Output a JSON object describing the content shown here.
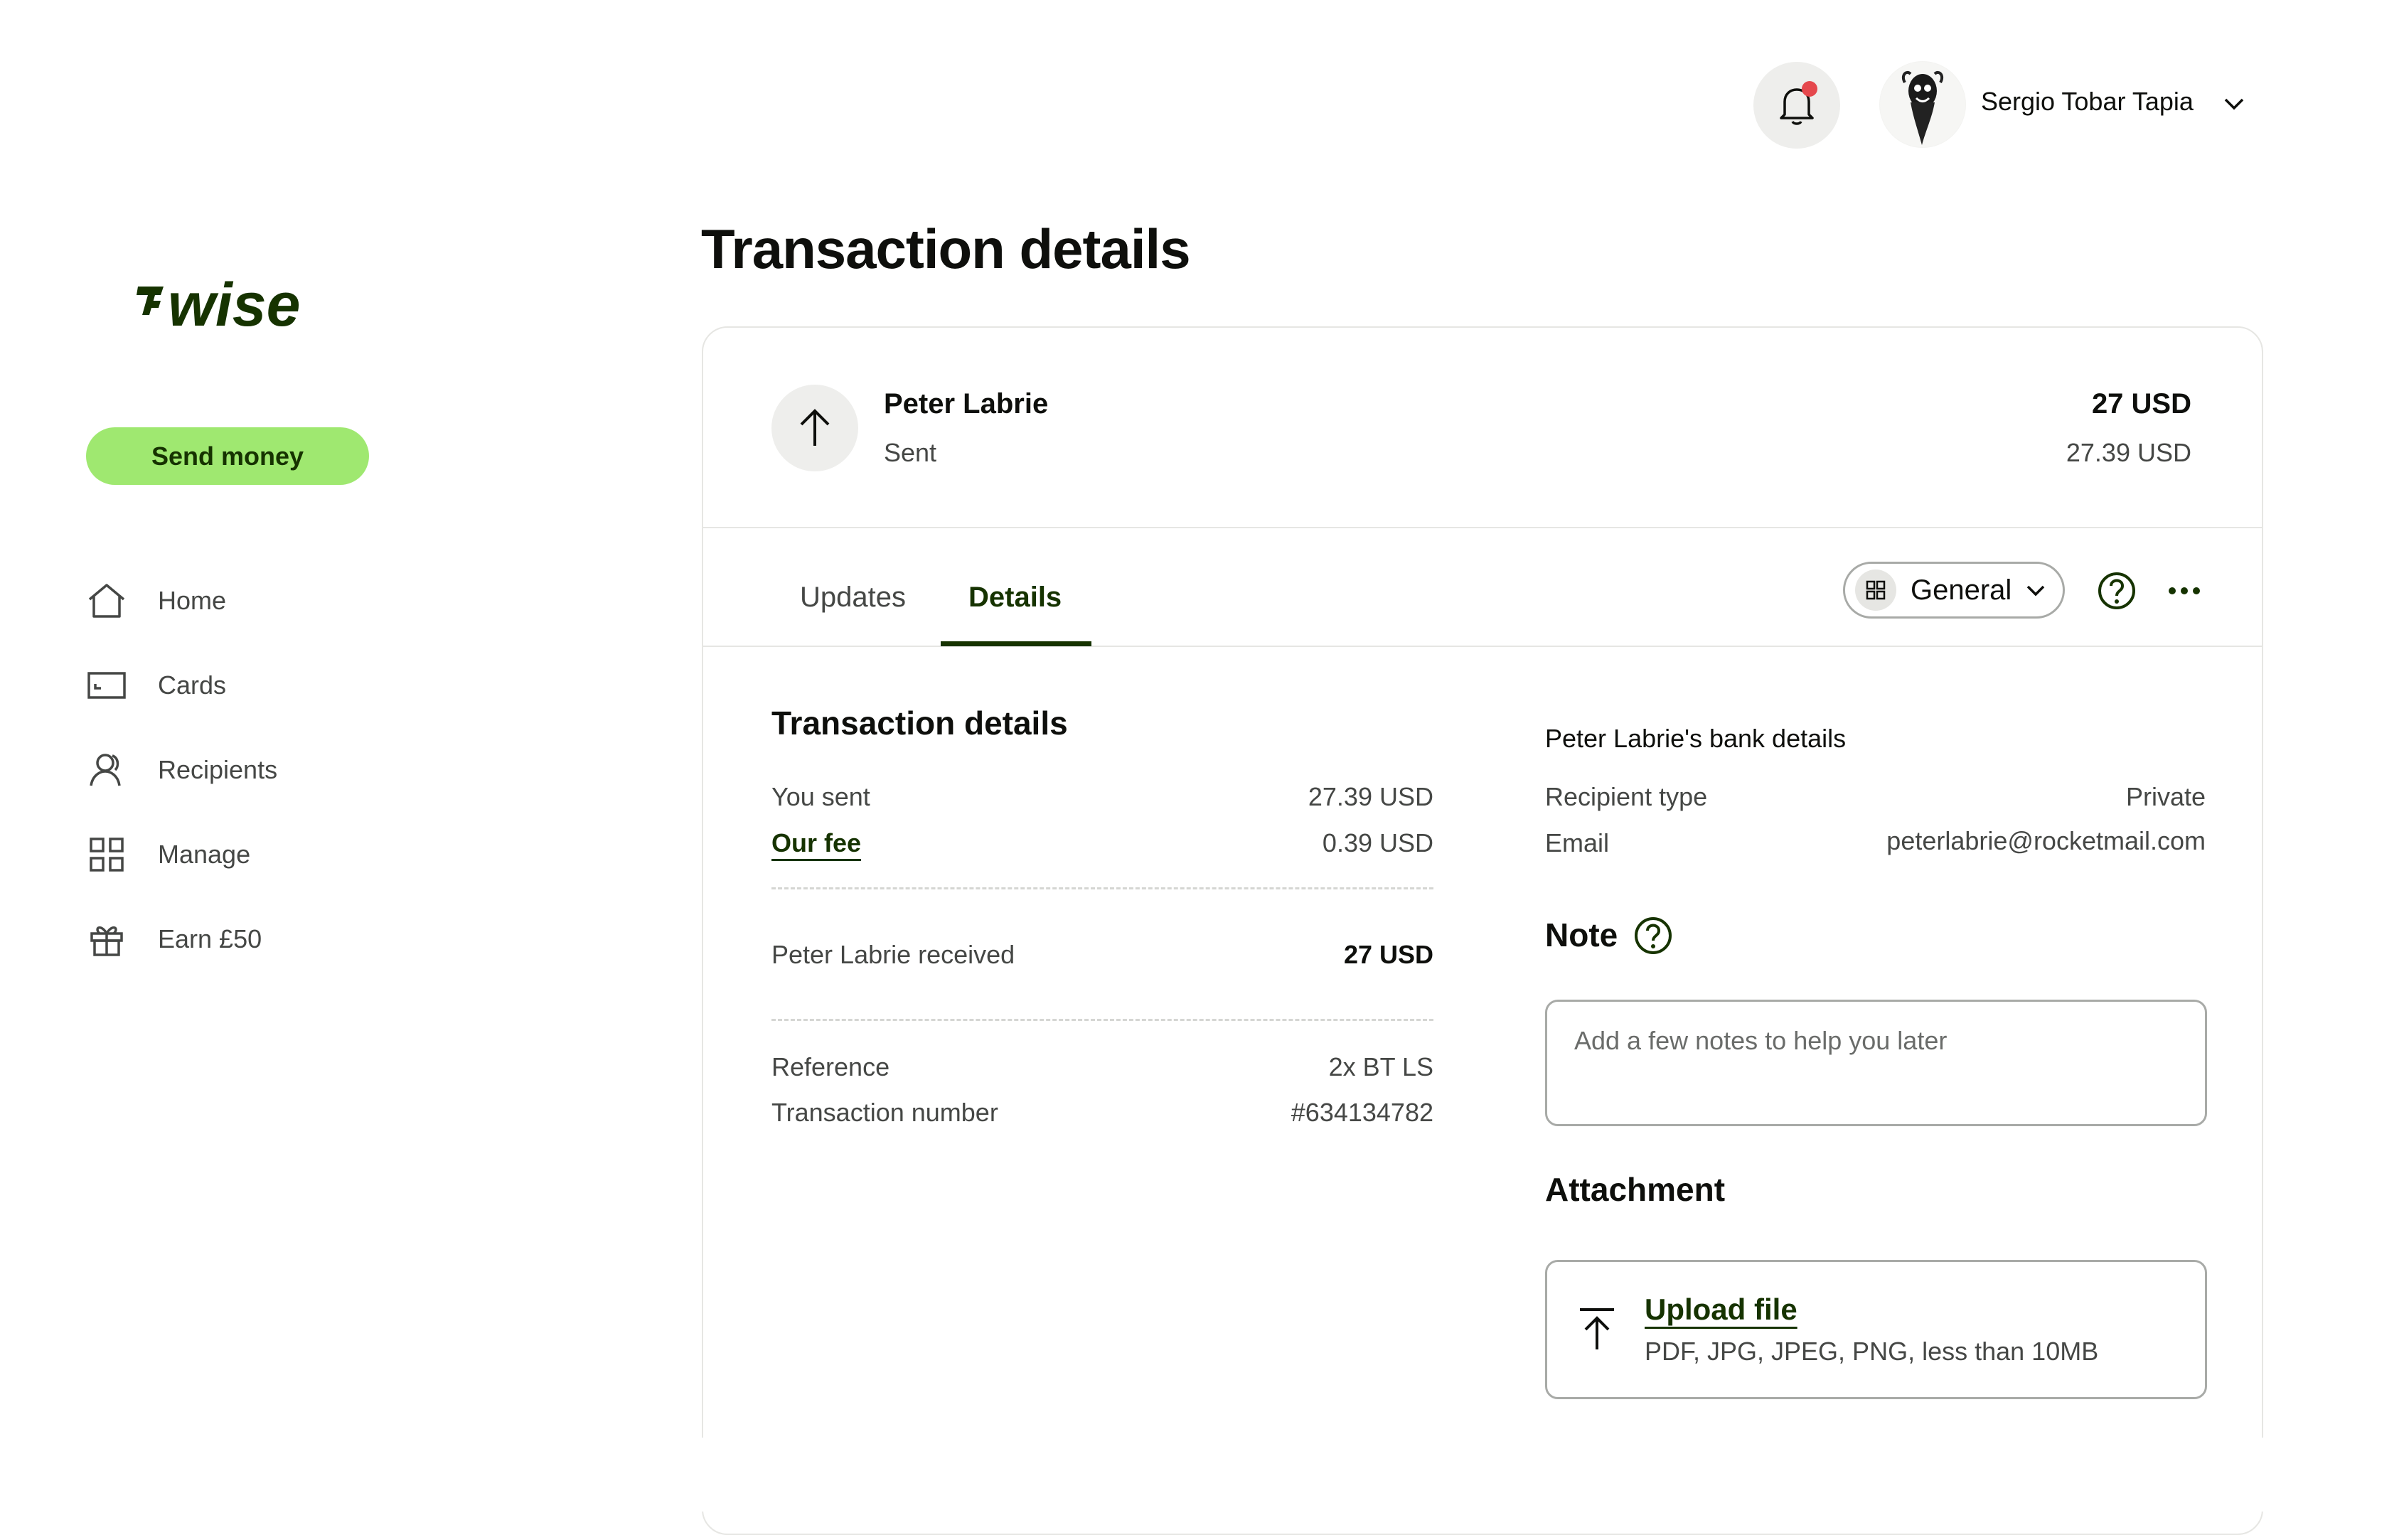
{
  "brand": {
    "logo_text": "wise",
    "accent": "#9fe870",
    "dark_green": "#163300"
  },
  "header": {
    "user_name": "Sergio Tobar Tapia",
    "notification_icon": "bell-icon",
    "has_unread": true
  },
  "sidebar": {
    "send_money_label": "Send money",
    "items": [
      {
        "label": "Home",
        "icon": "home-icon"
      },
      {
        "label": "Cards",
        "icon": "card-icon"
      },
      {
        "label": "Recipients",
        "icon": "recipients-icon"
      },
      {
        "label": "Manage",
        "icon": "grid-icon"
      },
      {
        "label": "Earn £50",
        "icon": "gift-icon"
      }
    ]
  },
  "page": {
    "title": "Transaction details"
  },
  "transaction": {
    "name": "Peter Labrie",
    "status": "Sent",
    "amount": "27 USD",
    "sub_amount": "27.39 USD"
  },
  "tabs": {
    "items": [
      {
        "label": "Updates"
      },
      {
        "label": "Details"
      }
    ],
    "active": "Details",
    "category_label": "General"
  },
  "details": {
    "title": "Transaction details",
    "you_sent_label": "You sent",
    "you_sent_value": "27.39 USD",
    "fee_label": "Our fee",
    "fee_value": "0.39 USD",
    "received_label": "Peter Labrie received",
    "received_value": "27 USD",
    "reference_label": "Reference",
    "reference_value": "2x BT LS",
    "tx_number_label": "Transaction number",
    "tx_number_value": "#634134782"
  },
  "bank": {
    "title": "Peter Labrie's bank details",
    "recipient_type_label": "Recipient type",
    "recipient_type_value": "Private",
    "email_label": "Email",
    "email_value": "peterlabrie@rocketmail.com"
  },
  "note": {
    "title": "Note",
    "placeholder": "Add a few notes to help you later"
  },
  "attachment": {
    "title": "Attachment",
    "upload_label": "Upload file",
    "hint": "PDF, JPG, JPEG, PNG, less than 10MB"
  }
}
